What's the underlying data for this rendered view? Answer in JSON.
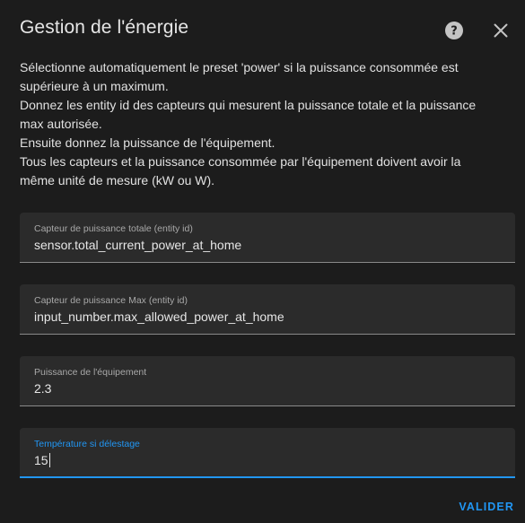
{
  "dialog": {
    "title": "Gestion de l'énergie",
    "help_icon": "help-circle-icon",
    "close_icon": "close-icon"
  },
  "description": {
    "line1": "Sélectionne automatiquement le preset 'power' si la puissance consommée est\nsupérieure à un maximum.",
    "line2": "Donnez les entity id des capteurs qui mesurent la puissance totale et la puissance\nmax autorisée.",
    "line3": "Ensuite donnez la puissance de l'équipement.",
    "line4": "Tous les capteurs et la puissance consommée par l'équipement doivent avoir la\nmême unité de mesure (kW ou W)."
  },
  "fields": [
    {
      "label": "Capteur de puissance totale (entity id)",
      "value": "sensor.total_current_power_at_home"
    },
    {
      "label": "Capteur de puissance Max (entity id)",
      "value": "input_number.max_allowed_power_at_home"
    },
    {
      "label": "Puissance de l'équipement",
      "value": "2.3"
    },
    {
      "label": "Température si délestage",
      "value": "15"
    }
  ],
  "actions": {
    "submit_label": "VALIDER"
  },
  "colors": {
    "accent": "#2196f3",
    "background": "#1c1c1c",
    "field_background": "#2b2b2b"
  }
}
